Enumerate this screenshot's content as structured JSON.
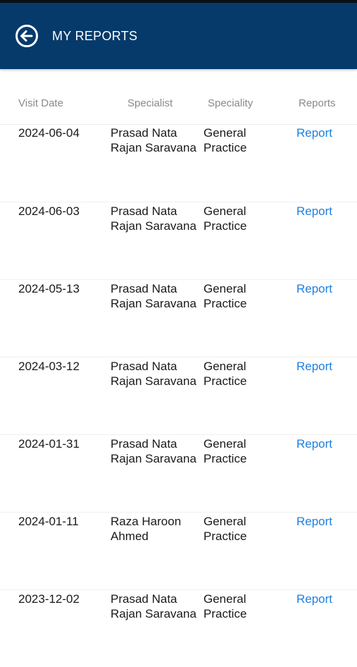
{
  "header": {
    "title": "MY REPORTS",
    "back_icon": "back-arrow-circle-icon"
  },
  "table": {
    "columns": [
      "Visit Date",
      "Specialist",
      "Speciality",
      "Reports"
    ],
    "rows": [
      {
        "date": "2024-06-04",
        "specialist_line1": "Prasad Nata",
        "specialist_line2": "Rajan Saravana",
        "speciality_line1": "General",
        "speciality_line2": "Practice",
        "report": "Report"
      },
      {
        "date": "2024-06-03",
        "specialist_line1": "Prasad Nata",
        "specialist_line2": "Rajan Saravana",
        "speciality_line1": "General",
        "speciality_line2": "Practice",
        "report": "Report"
      },
      {
        "date": "2024-05-13",
        "specialist_line1": "Prasad Nata",
        "specialist_line2": "Rajan Saravana",
        "speciality_line1": "General",
        "speciality_line2": "Practice",
        "report": "Report"
      },
      {
        "date": "2024-03-12",
        "specialist_line1": "Prasad Nata",
        "specialist_line2": "Rajan Saravana",
        "speciality_line1": "General",
        "speciality_line2": "Practice",
        "report": "Report"
      },
      {
        "date": "2024-01-31",
        "specialist_line1": "Prasad Nata",
        "specialist_line2": "Rajan Saravana",
        "speciality_line1": "General",
        "speciality_line2": "Practice",
        "report": "Report"
      },
      {
        "date": "2024-01-11",
        "specialist_line1": "Raza Haroon",
        "specialist_line2": "Ahmed",
        "speciality_line1": "General",
        "speciality_line2": "Practice",
        "report": "Report"
      },
      {
        "date": "2023-12-02",
        "specialist_line1": "Prasad Nata",
        "specialist_line2": "Rajan Saravana",
        "speciality_line1": "General",
        "speciality_line2": "Practice",
        "report": "Report"
      }
    ]
  },
  "colors": {
    "header_bg": "#063a6b",
    "link": "#1d7fe0",
    "column_header_text": "#8a8a8a"
  }
}
